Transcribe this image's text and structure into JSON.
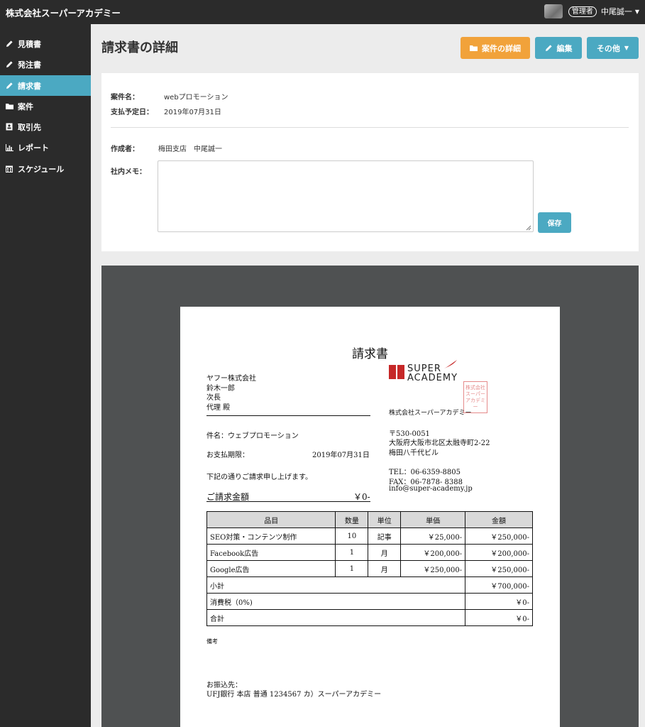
{
  "app": {
    "brand": "株式会社スーパーアカデミー"
  },
  "user": {
    "role": "管理者",
    "name": "中尾誠一"
  },
  "sidebar": {
    "items": [
      {
        "label": "見積書",
        "icon": "pencil-icon"
      },
      {
        "label": "発注書",
        "icon": "pencil-icon"
      },
      {
        "label": "請求書",
        "icon": "pencil-icon",
        "active": true
      },
      {
        "label": "案件",
        "icon": "folder-icon"
      },
      {
        "label": "取引先",
        "icon": "address-book-icon"
      },
      {
        "label": "レポート",
        "icon": "bar-chart-icon"
      },
      {
        "label": "スケジュール",
        "icon": "calendar-icon"
      }
    ]
  },
  "header": {
    "title": "請求書の詳細",
    "buttons": {
      "project": "案件の詳細",
      "edit": "編集",
      "more": "その他"
    }
  },
  "details": {
    "project_label": "案件名：",
    "project_value": "webプロモーション",
    "due_label": "支払予定日：",
    "due_value": "2019年07月31日",
    "author_label": "作成者：",
    "author_value": "梅田支店　中尾誠一",
    "memo_label": "社内メモ：",
    "memo_value": "",
    "save": "保存"
  },
  "invoice": {
    "title": "請求書",
    "recipient": [
      "ヤフー株式会社",
      "鈴木一郎",
      "次長",
      "代理 殿"
    ],
    "subject": "件名：ウェブプロモーション",
    "deadline_label": "お支払期限：",
    "deadline_value": "2019年07月31日",
    "note": "下記の通りご請求申し上げます。",
    "amount_label": "ご請求金額",
    "amount_value": "￥0-",
    "logo_line1": "SUPER",
    "logo_line2": "ACADEMY",
    "stamp": "株式会社スーパーアカデミー",
    "company": "株式会社スーパーアカデミー",
    "postal": "〒530-0051",
    "address1": "大阪府大阪市北区太融寺町2-22",
    "address2": "梅田八千代ビル",
    "tel": "TEL：06-6359-8805",
    "fax": "FAX：06-7878- 8388",
    "email": "info@super-academy.jp",
    "table": {
      "headers": [
        "品目",
        "数量",
        "単位",
        "単価",
        "金額"
      ],
      "rows": [
        {
          "item": "SEO対策・コンテンツ制作",
          "qty": "10",
          "unit": "記事",
          "price": "￥25,000-",
          "amount": "￥250,000-"
        },
        {
          "item": "Facebook広告",
          "qty": "1",
          "unit": "月",
          "price": "￥200,000-",
          "amount": "￥200,000-"
        },
        {
          "item": "Google広告",
          "qty": "1",
          "unit": "月",
          "price": "￥250,000-",
          "amount": "￥250,000-"
        }
      ],
      "subtotal_label": "小計",
      "subtotal": "￥700,000-",
      "tax_label": "消費税（0%)",
      "tax": "￥0-",
      "total_label": "合計",
      "total": "￥0-"
    },
    "remarks_label": "備考",
    "transfer_label": "お振込先：",
    "transfer_value": "UFJ銀行 本店 普通 1234567 カ）スーパーアカデミー"
  }
}
